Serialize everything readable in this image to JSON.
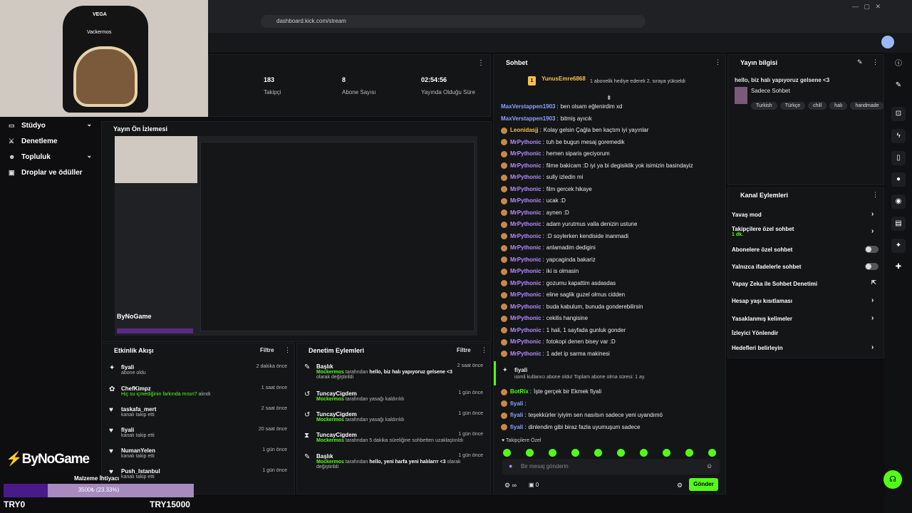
{
  "browser": {
    "url": "dashboard.kick.com/stream"
  },
  "sidebar": {
    "items": [
      {
        "label": "Stüdyo"
      },
      {
        "label": "Denetleme"
      },
      {
        "label": "Topluluk"
      },
      {
        "label": "Droplar ve ödüller"
      }
    ]
  },
  "stats": [
    {
      "value": "183",
      "label": "Takipçi"
    },
    {
      "value": "8",
      "label": "Abone Sayısı"
    },
    {
      "value": "02:54:56",
      "label": "Yayında Olduğu Süre"
    }
  ],
  "preview": {
    "title": "Yayın Ön İzlemesi"
  },
  "activity": {
    "title": "Etkinlik Akışı",
    "filter": "Filtre",
    "rows": [
      {
        "name": "fiyali",
        "sub": "abone oldu",
        "time": "2 dakika önce",
        "icon": "star"
      },
      {
        "name": "ChefKimpz",
        "sub": "Hiç su içmediğinin farkında mısın?",
        "sub2": "alındı",
        "time": "1 saat önce",
        "icon": "gift"
      },
      {
        "name": "taskafa_mert",
        "sub": "kanalı takip etti",
        "time": "2 saat önce",
        "icon": "heart"
      },
      {
        "name": "fiyali",
        "sub": "kanalı takip etti",
        "time": "20 saat önce",
        "icon": "heart"
      },
      {
        "name": "NumanYelen",
        "sub": "kanalı takip etti",
        "time": "1 gün önce",
        "icon": "heart"
      },
      {
        "name": "Push_Istanbul",
        "sub": "kanalı takip etti",
        "time": "1 gün önce",
        "icon": "heart"
      }
    ]
  },
  "modlog": {
    "title": "Denetim Eylemleri",
    "filter": "Filtre",
    "rows": [
      {
        "name": "Başlık",
        "actor": "Mockermos",
        "text": "tarafından",
        "bold": "hello, biz halı yapıyoruz gelsene <3",
        "tail": "olarak değiştirildi",
        "time": "2 saat önce"
      },
      {
        "name": "TuncayCigdem",
        "actor": "Mockermos",
        "text": "tarafından yasağı kaldırıldı",
        "time": "1 gün önce"
      },
      {
        "name": "TuncayCigdem",
        "actor": "Mockermos",
        "text": "tarafından yasağı kaldırıldı",
        "time": "1 gün önce"
      },
      {
        "name": "TuncayCigdem",
        "actor": "Mockermos",
        "text": "tarafından 5 dakika süreliğine sohbetten uzaklaştırıldı",
        "time": "1 gün önce"
      },
      {
        "name": "Başlık",
        "actor": "Mockermos",
        "text": "tarafından",
        "bold": "hello, yeni harfa yeni halılarrr <3",
        "tail": "olarak değiştirildi",
        "time": "1 gün önce"
      }
    ]
  },
  "chat": {
    "title": "Sohbet",
    "pinned_user": "YunusEmre6868",
    "pinned_text": "1 abonelik hediye ederek 2. sıraya yükseldi",
    "pinned_rank": "1",
    "messages": [
      {
        "user": "MaxVerstappen1903",
        "color": "blue",
        "text": "ben olsam eğlenirdim xd"
      },
      {
        "user": "MaxVerstappen1903",
        "color": "blue",
        "text": "bitmiş ayıcık"
      },
      {
        "user": "Leonidasjj",
        "color": "yellow",
        "text": "Kolay gelsin Çağla ben kaçtım iyi yayınlar"
      },
      {
        "user": "MrPythonic",
        "color": "purple",
        "text": "tuh be bugun mesaj goremedik"
      },
      {
        "user": "MrPythonic",
        "color": "purple",
        "text": "hemen siparis geciyorum"
      },
      {
        "user": "MrPythonic",
        "color": "purple",
        "text": "filme bakicam :D iyi ya bi degisiklik yok isimizin basindayiz"
      },
      {
        "user": "MrPythonic",
        "color": "purple",
        "text": "sully izledin mi"
      },
      {
        "user": "MrPythonic",
        "color": "purple",
        "text": "film gercek hikaye"
      },
      {
        "user": "MrPythonic",
        "color": "purple",
        "text": "ucak :D"
      },
      {
        "user": "MrPythonic",
        "color": "purple",
        "text": "aynen :D"
      },
      {
        "user": "MrPythonic",
        "color": "purple",
        "text": "adam yurutmus valla denizin ustune"
      },
      {
        "user": "MrPythonic",
        "color": "purple",
        "text": ":D soylerken kendiside inanmadi"
      },
      {
        "user": "MrPythonic",
        "color": "purple",
        "text": "anlamadim dedigini"
      },
      {
        "user": "MrPythonic",
        "color": "purple",
        "text": "yapcaginda bakariz"
      },
      {
        "user": "MrPythonic",
        "color": "purple",
        "text": "iki is olmasin"
      },
      {
        "user": "MrPythonic",
        "color": "purple",
        "text": "gozumu kapattim asdasdas"
      },
      {
        "user": "MrPythonic",
        "color": "purple",
        "text": "eline saglik guzel olmus cidden"
      },
      {
        "user": "MrPythonic",
        "color": "purple",
        "text": "buda kabulum, bunuda gonderebilirsin"
      },
      {
        "user": "MrPythonic",
        "color": "purple",
        "text": "cekilis hangisine"
      },
      {
        "user": "MrPythonic",
        "color": "purple",
        "text": "1 hali, 1 sayfada gunluk gonder"
      },
      {
        "user": "MrPythonic",
        "color": "purple",
        "text": "fotokopi denen bisey var :D"
      },
      {
        "user": "MrPythonic",
        "color": "purple",
        "text": "1 adet ip sarma makinesi"
      }
    ],
    "sub_event": {
      "user": "fiyali",
      "text": "isimli kullanıcı abone oldu! Toplam abone olma süresi: 1 ay."
    },
    "messages2": [
      {
        "user": "BotRix",
        "color": "green",
        "text": "İşte gerçek bir Ekmek fiyali"
      },
      {
        "user": "fiyali",
        "color": "blue",
        "text": ""
      },
      {
        "user": "fiyali",
        "color": "blue",
        "text": "teşekkürler iyiyim sen nasılsın sadece yeni uyandımö"
      },
      {
        "user": "fiyali",
        "color": "blue",
        "text": "dinlendim gibi biraz fazla uyumuşum sadece"
      }
    ],
    "followers_only": "Takipçilere Özel",
    "input_placeholder": "Bir mesaj gönderin",
    "send": "Gönder",
    "count": "0"
  },
  "stream_info": {
    "title": "Yayın bilgisi",
    "stream_title": "hello, biz halı yapıyoruz gelsene <3",
    "category": "Sadece Sohbet",
    "tags": [
      "Turkish",
      "Türkçe",
      "chill",
      "halı",
      "handmade"
    ]
  },
  "channel_actions": {
    "title": "Kanal Eylemleri",
    "items": [
      {
        "label": "Yavaş mod"
      },
      {
        "label": "Takipçilere özel sohbet",
        "sub": "1 dk."
      },
      {
        "label": "Abonelere özel sohbet"
      },
      {
        "label": "Yalnızca ifadelerle sohbet"
      },
      {
        "label": "Yapay Zeka ile Sohbet Denetimi"
      },
      {
        "label": "Hesap yaşı kısıtlaması"
      },
      {
        "label": "Yasaklanmış kelimeler"
      },
      {
        "label": "İzleyici Yönlendir"
      },
      {
        "label": "Hedefleri belirleyin"
      }
    ]
  },
  "overlay": {
    "logo": "ByNoGame",
    "goal_title": "Malzeme İhtiyacı",
    "goal_progress": "3500₺ (23.33%)",
    "goal_fraction": 0.2333,
    "goal_min": "TRY0",
    "goal_max": "TRY15000",
    "chair_brand": "VEGA",
    "chair_name": "Vackermos"
  }
}
